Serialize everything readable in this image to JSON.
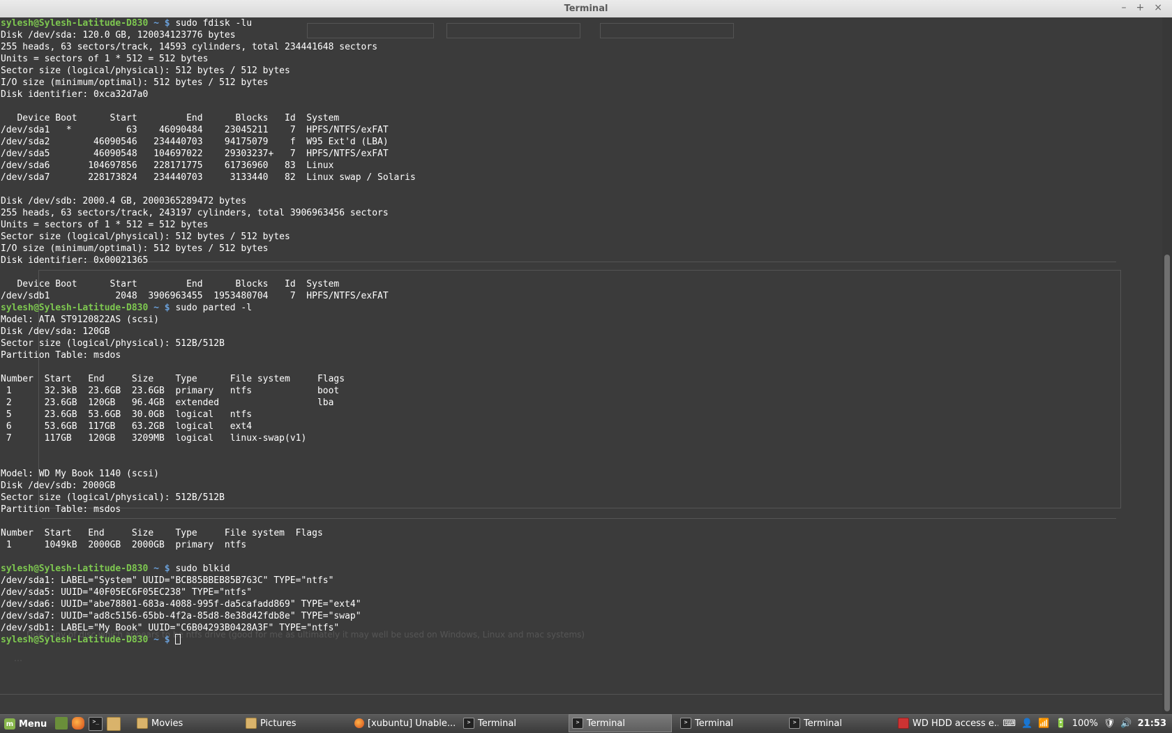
{
  "window": {
    "title": "Terminal",
    "controls": [
      "–",
      "+",
      "×"
    ]
  },
  "terminal": {
    "prompt_user": "sylesh@Sylesh-Latitude-D830",
    "prompt_path": "~ $",
    "commands": [
      "sudo fdisk -lu",
      "sudo parted -l",
      "sudo blkid",
      ""
    ],
    "fdisk_output": "Disk /dev/sda: 120.0 GB, 120034123776 bytes\n255 heads, 63 sectors/track, 14593 cylinders, total 234441648 sectors\nUnits = sectors of 1 * 512 = 512 bytes\nSector size (logical/physical): 512 bytes / 512 bytes\nI/O size (minimum/optimal): 512 bytes / 512 bytes\nDisk identifier: 0xca32d7a0\n\n   Device Boot      Start         End      Blocks   Id  System\n/dev/sda1   *          63    46090484    23045211    7  HPFS/NTFS/exFAT\n/dev/sda2        46090546   234440703    94175079    f  W95 Ext'd (LBA)\n/dev/sda5        46090548   104697022    29303237+   7  HPFS/NTFS/exFAT\n/dev/sda6       104697856   228171775    61736960   83  Linux\n/dev/sda7       228173824   234440703     3133440   82  Linux swap / Solaris\n\nDisk /dev/sdb: 2000.4 GB, 2000365289472 bytes\n255 heads, 63 sectors/track, 243197 cylinders, total 3906963456 sectors\nUnits = sectors of 1 * 512 = 512 bytes\nSector size (logical/physical): 512 bytes / 512 bytes\nI/O size (minimum/optimal): 512 bytes / 512 bytes\nDisk identifier: 0x00021365\n\n   Device Boot      Start         End      Blocks   Id  System\n/dev/sdb1            2048  3906963455  1953480704    7  HPFS/NTFS/exFAT",
    "parted_output": "Model: ATA ST9120822AS (scsi)\nDisk /dev/sda: 120GB\nSector size (logical/physical): 512B/512B\nPartition Table: msdos\n\nNumber  Start   End     Size    Type      File system     Flags\n 1      32.3kB  23.6GB  23.6GB  primary   ntfs            boot\n 2      23.6GB  120GB   96.4GB  extended                  lba\n 5      23.6GB  53.6GB  30.0GB  logical   ntfs\n 6      53.6GB  117GB   63.2GB  logical   ext4\n 7      117GB   120GB   3209MB  logical   linux-swap(v1)\n\n\nModel: WD My Book 1140 (scsi)\nDisk /dev/sdb: 2000GB\nSector size (logical/physical): 512B/512B\nPartition Table: msdos\n\nNumber  Start   End     Size    Type     File system  Flags\n 1      1049kB  2000GB  2000GB  primary  ntfs\n",
    "blkid_output": "/dev/sda1: LABEL=\"System\" UUID=\"BCB85BBEB85B763C\" TYPE=\"ntfs\"\n/dev/sda5: UUID=\"40F05EC6F05EC238\" TYPE=\"ntfs\"\n/dev/sda6: UUID=\"abe78801-683a-4088-995f-da5cafadd869\" TYPE=\"ext4\"\n/dev/sda7: UUID=\"ad8c5156-65bb-4f2a-85d8-8e38d42fdb8e\" TYPE=\"swap\"\n/dev/sdb1: LABEL=\"My Book\" UUID=\"C6B04293B0428A3F\" TYPE=\"ntfs\"",
    "background_text": "Does any of disc which appears to be ntfs drive (good for me as ultimately it may well be used on Windows, Linux and mac systems)"
  },
  "taskbar": {
    "menu_label": "Menu",
    "windows": [
      {
        "label": "Movies",
        "icon": "folder-icon"
      },
      {
        "label": "Pictures",
        "icon": "folder-icon"
      },
      {
        "label": "[xubuntu] Unable...",
        "icon": "firefox-icon"
      },
      {
        "label": "Terminal",
        "icon": "terminal-icon"
      },
      {
        "label": "Terminal",
        "icon": "terminal-icon",
        "active": true
      },
      {
        "label": "Terminal",
        "icon": "terminal-icon"
      },
      {
        "label": "Terminal",
        "icon": "terminal-icon"
      },
      {
        "label": "WD HDD access e...",
        "icon": "app-icon"
      }
    ],
    "battery": "100%",
    "clock": "21:53"
  },
  "colors": {
    "background": "#3b3b3b",
    "prompt_user": "#7ec850",
    "prompt_path": "#6a9fd8",
    "text": "#ffffff"
  }
}
